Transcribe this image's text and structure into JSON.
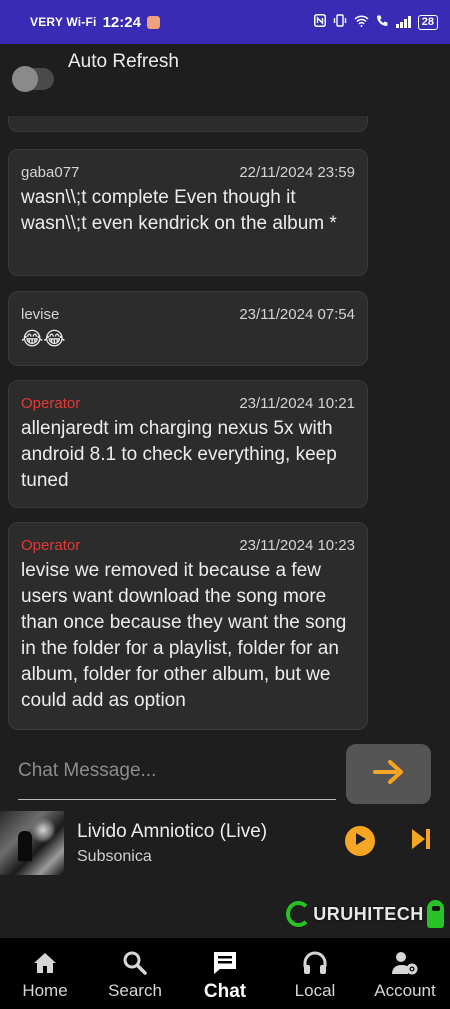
{
  "status_bar": {
    "carrier": "VERY Wi-Fi",
    "time": "12:24",
    "battery": "28"
  },
  "header": {
    "title": "Auto Refresh",
    "toggle_on": false
  },
  "messages": [
    {
      "user": "gaba077",
      "time": "22/11/2024 23:59",
      "text": "wasn\\\\;t complete Even though it wasn\\\\;t even kendrick on the album *",
      "operator": false
    },
    {
      "user": "levise",
      "time": "23/11/2024 07:54",
      "text": "😂😂",
      "operator": false
    },
    {
      "user": "Operator",
      "time": "23/11/2024 10:21",
      "text": "allenjaredt im charging nexus 5x with android 8.1 to check everything, keep tuned",
      "operator": true
    },
    {
      "user": "Operator",
      "time": "23/11/2024 10:23",
      "text": "levise we removed it because a few users want download the song more than once because they want the song in the folder for a playlist, folder for an album, folder for other album, but we could add as option",
      "operator": true
    }
  ],
  "chat_input": {
    "placeholder": "Chat Message...",
    "value": ""
  },
  "player": {
    "title": "Livido Amniotico (Live)",
    "artist": "Subsonica"
  },
  "watermark": {
    "text": "URUHITECH"
  },
  "nav": [
    {
      "label": "Home",
      "icon": "home-icon",
      "active": false
    },
    {
      "label": "Search",
      "icon": "search-icon",
      "active": false
    },
    {
      "label": "Chat",
      "icon": "chat-icon",
      "active": true
    },
    {
      "label": "Local",
      "icon": "headphones-icon",
      "active": false
    },
    {
      "label": "Account",
      "icon": "account-settings-icon",
      "active": false
    }
  ],
  "colors": {
    "accent": "#f6a623",
    "operator": "#e53935",
    "status_bar": "#3a2bb4",
    "background": "#1e1e1e"
  }
}
